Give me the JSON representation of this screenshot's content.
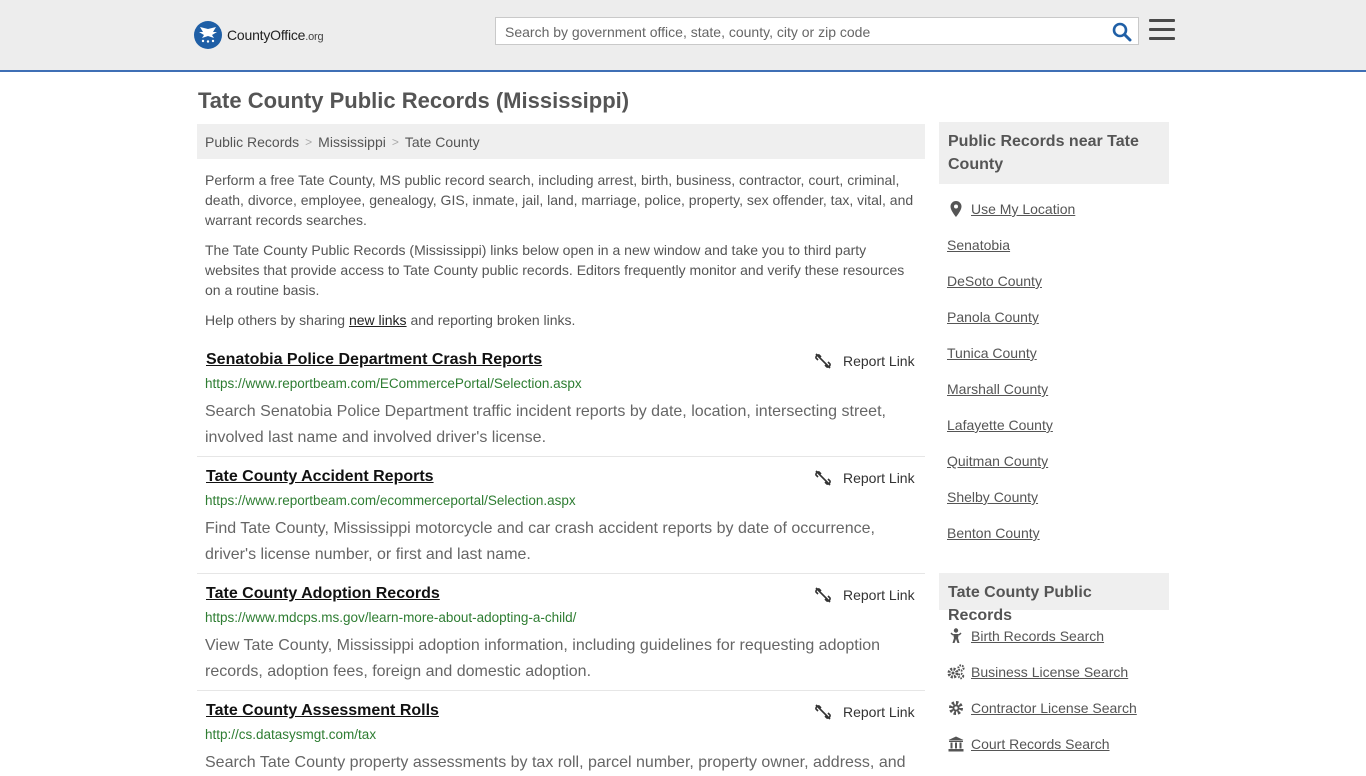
{
  "header": {
    "logo_brand": "CountyOffice",
    "logo_tld": ".org",
    "search_placeholder": "Search by government office, state, county, city or zip code"
  },
  "page": {
    "title": "Tate County Public Records (Mississippi)"
  },
  "breadcrumb": [
    "Public Records",
    "Mississippi",
    "Tate County"
  ],
  "intro": {
    "p1": "Perform a free Tate County, MS public record search, including arrest, birth, business, contractor, court, criminal, death, divorce, employee, genealogy, GIS, inmate, jail, land, marriage, police, property, sex offender, tax, vital, and warrant records searches.",
    "p2": "The Tate County Public Records (Mississippi) links below open in a new window and take you to third party websites that provide access to Tate County public records. Editors frequently monitor and verify these resources on a routine basis.",
    "p3_before": "Help others by sharing ",
    "p3_link": "new links",
    "p3_after": " and reporting broken links."
  },
  "report_label": "Report Link",
  "results": [
    {
      "title": "Senatobia Police Department Crash Reports",
      "url": "https://www.reportbeam.com/ECommercePortal/Selection.aspx",
      "desc": "Search Senatobia Police Department traffic incident reports by date, location, intersecting street, involved last name and involved driver's license."
    },
    {
      "title": "Tate County Accident Reports",
      "url": "https://www.reportbeam.com/ecommerceportal/Selection.aspx",
      "desc": "Find Tate County, Mississippi motorcycle and car crash accident reports by date of occurrence, driver's license number, or first and last name."
    },
    {
      "title": "Tate County Adoption Records",
      "url": "https://www.mdcps.ms.gov/learn-more-about-adopting-a-child/",
      "desc": "View Tate County, Mississippi adoption information, including guidelines for requesting adoption records, adoption fees, foreign and domestic adoption."
    },
    {
      "title": "Tate County Assessment Rolls",
      "url": "http://cs.datasysmgt.com/tax",
      "desc": "Search Tate County property assessments by tax roll, parcel number, property owner, address, and"
    }
  ],
  "sidebar": {
    "nearby_title": "Public Records near Tate County",
    "use_location": "Use My Location",
    "nearby": [
      "Senatobia",
      "DeSoto County",
      "Panola County",
      "Tunica County",
      "Marshall County",
      "Lafayette County",
      "Quitman County",
      "Shelby County",
      "Benton County"
    ],
    "county_title": "Tate County Public Records",
    "county_links": [
      {
        "label": "Birth Records Search",
        "icon": "baby-icon"
      },
      {
        "label": "Business License Search",
        "icon": "gears-icon"
      },
      {
        "label": "Contractor License Search",
        "icon": "gear-icon"
      },
      {
        "label": "Court Records Search",
        "icon": "courthouse-icon"
      }
    ]
  },
  "colors": {
    "accent": "#3f6fb5",
    "url_green": "#2e7d32",
    "logo_blue": "#1f5fa6"
  }
}
